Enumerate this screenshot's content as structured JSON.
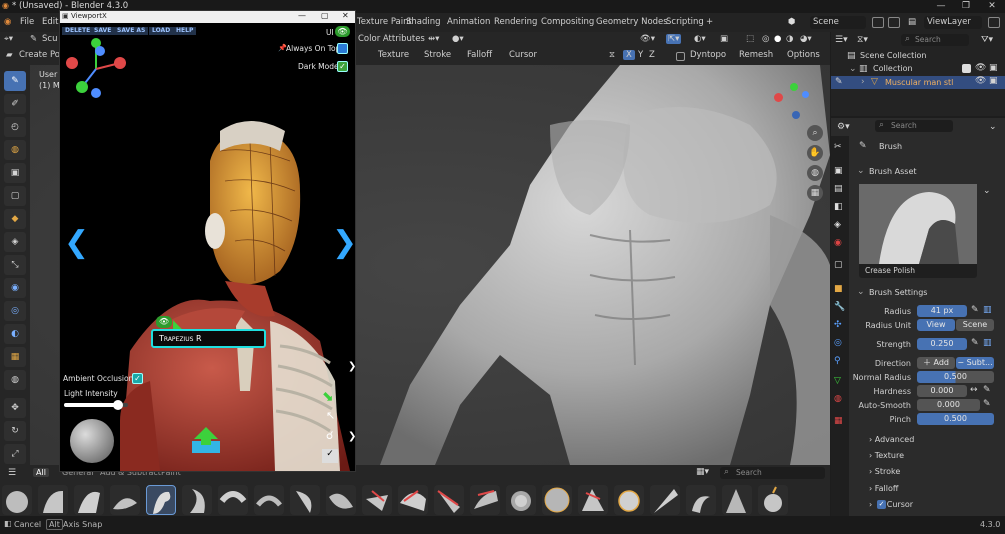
{
  "window": {
    "title": "* (Unsaved) - Blender 4.3.0",
    "minimize": "—",
    "maximize": "❐",
    "close": "✕"
  },
  "menu": {
    "file": "File",
    "edit": "Edit"
  },
  "workspace_tabs": [
    "Texture Paint",
    "Shading",
    "Animation",
    "Rendering",
    "Compositing",
    "Geometry Nodes",
    "Scripting"
  ],
  "add_tab": "+",
  "scene": {
    "label": "Scene",
    "viewlayer": "ViewLayer"
  },
  "header": {
    "mode_partial": "Scu",
    "color_attributes": "Color Attributes"
  },
  "tool_header": {
    "tool_name": "Create Pol",
    "texture": "Texture",
    "stroke": "Stroke",
    "falloff": "Falloff",
    "cursor": "Cursor",
    "axis_x": "X",
    "axis_y": "Y",
    "axis_z": "Z",
    "dyntopo": "Dyntopo",
    "remesh": "Remesh",
    "options": "Options"
  },
  "viewport_overlay": {
    "line1": "User",
    "line2": "(1) M"
  },
  "outliner": {
    "search_placeholder": "Search",
    "root": "Scene Collection",
    "collection": "Collection",
    "object": "Muscular man stl"
  },
  "properties": {
    "search_placeholder": "Search",
    "header": "Brush",
    "brush_asset_label": "Brush Asset",
    "brush_name": "Crease Polish",
    "brush_settings_label": "Brush Settings",
    "radius_label": "Radius",
    "radius_value": "41 px",
    "radius_unit_label": "Radius Unit",
    "radius_unit_view": "View",
    "radius_unit_scene": "Scene",
    "strength_label": "Strength",
    "strength_value": "0.250",
    "direction_label": "Direction",
    "direction_add": "Add",
    "direction_sub": "Subt...",
    "normal_radius_label": "Normal Radius",
    "normal_radius_value": "0.500",
    "hardness_label": "Hardness",
    "hardness_value": "0.000",
    "autosmooth_label": "Auto-Smooth",
    "autosmooth_value": "0.000",
    "pinch_label": "Pinch",
    "pinch_value": "0.500",
    "advanced": "Advanced",
    "texture": "Texture",
    "stroke": "Stroke",
    "falloff": "Falloff",
    "cursor": "Cursor"
  },
  "shelf": {
    "tab_all": "All",
    "tab_general": "General",
    "tab_add_subtract": "Add & Subtract",
    "tab_paint": "Paint",
    "search_placeholder": "Search"
  },
  "status": {
    "cancel": "Cancel",
    "alt_key": "Alt",
    "axis_snap": "Axis Snap",
    "version": "4.3.0"
  },
  "viewportx": {
    "title": "ViewportX",
    "delete": "DELETE",
    "save": "SAVE",
    "save_as": "SAVE AS",
    "load": "LOAD",
    "help": "HELP",
    "ui_label": "UI",
    "always_on_top": "Always On Top",
    "dark_mode": "Dark Mode",
    "muscle_label": "Trapezius R",
    "ambient_occlusion": "Ambient Occlusion",
    "light_intensity": "Light Intensity",
    "light_intensity_value": 0.85
  },
  "colors": {
    "accent": "#4772b3",
    "teal": "#1fe0e0",
    "green": "#3cd13c",
    "header": "#262626"
  }
}
